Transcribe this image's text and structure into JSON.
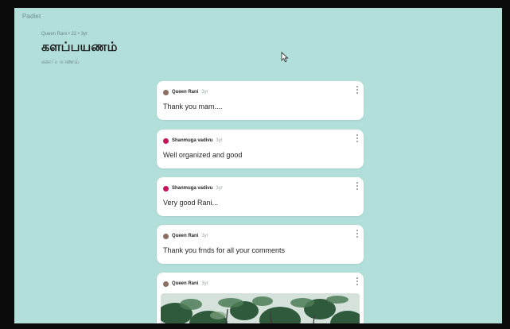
{
  "header": {
    "brand": "Padlet",
    "meta": "Queen Rani • 22 • 3yr",
    "title": "களப்பயணம்",
    "subtitle": "களப்பயணம்"
  },
  "posts": [
    {
      "author": "Queen Rani",
      "time": "3yr",
      "text": "Thank you mam....",
      "avatar_color": "#8d6e63"
    },
    {
      "author": "Shanmuga vadivu",
      "time": "3yr",
      "text": "Well organized and good",
      "avatar_color": "#c2185b"
    },
    {
      "author": "Shanmuga vadivu",
      "time": "3yr",
      "text": "Very good Rani...",
      "avatar_color": "#c2185b"
    },
    {
      "author": "Queen Rani",
      "time": "3yr",
      "text": "Thank you frnds for all your comments",
      "avatar_color": "#8d6e63"
    },
    {
      "author": "Queen Rani",
      "time": "3yr",
      "text": "",
      "avatar_color": "#8d6e63"
    }
  ]
}
